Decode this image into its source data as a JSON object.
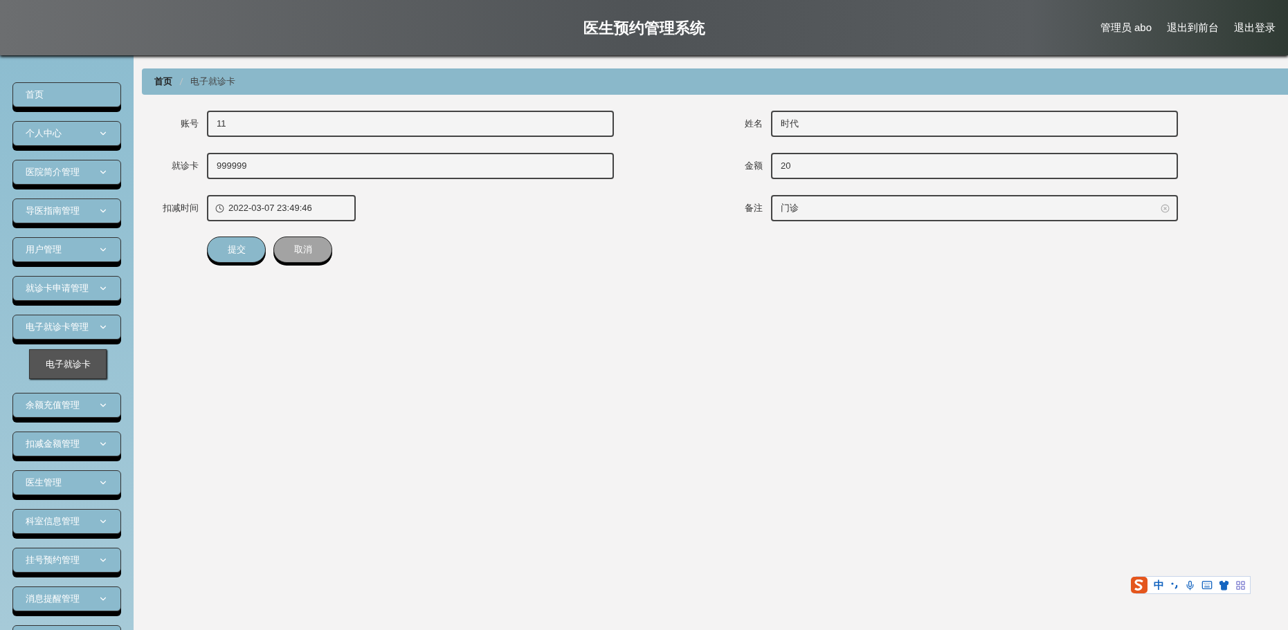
{
  "header": {
    "title": "医生预约管理系统",
    "user_label": "管理员 abo",
    "links": [
      "退出到前台",
      "退出登录"
    ]
  },
  "sidebar": {
    "items": [
      {
        "kind": "link",
        "label": "首页"
      },
      {
        "kind": "menu",
        "label": "个人中心"
      },
      {
        "kind": "menu",
        "label": "医院简介管理"
      },
      {
        "kind": "menu",
        "label": "导医指南管理"
      },
      {
        "kind": "menu",
        "label": "用户管理"
      },
      {
        "kind": "menu",
        "label": "就诊卡申请管理"
      },
      {
        "kind": "menu",
        "label": "电子就诊卡管理",
        "children": [
          {
            "label": "电子就诊卡",
            "selected": true
          }
        ]
      },
      {
        "kind": "menu",
        "label": "余额充值管理"
      },
      {
        "kind": "menu",
        "label": "扣减金额管理"
      },
      {
        "kind": "menu",
        "label": "医生管理"
      },
      {
        "kind": "menu",
        "label": "科室信息管理"
      },
      {
        "kind": "menu",
        "label": "挂号预约管理"
      },
      {
        "kind": "menu",
        "label": "消息提醒管理"
      },
      {
        "kind": "menu"
      }
    ]
  },
  "breadcrumb": [
    "首页",
    "电子就诊卡"
  ],
  "form": {
    "fields": [
      {
        "kind": "text",
        "label": "账号",
        "value": "11"
      },
      {
        "kind": "text",
        "label": "姓名",
        "value": "时代"
      },
      {
        "kind": "text",
        "label": "就诊卡",
        "value": "999999"
      },
      {
        "kind": "text",
        "label": "金额",
        "value": "20"
      },
      {
        "kind": "datetime",
        "label": "扣减时间",
        "value": "2022-03-07 23:49:46"
      },
      {
        "kind": "text",
        "label": "备注",
        "value": "门诊",
        "clearable": true
      }
    ],
    "buttons": [
      {
        "kind": "primary",
        "label": "提交"
      },
      {
        "kind": "secondary",
        "label": "取消"
      }
    ]
  },
  "ime_toolbar": {
    "mode": "中"
  }
}
